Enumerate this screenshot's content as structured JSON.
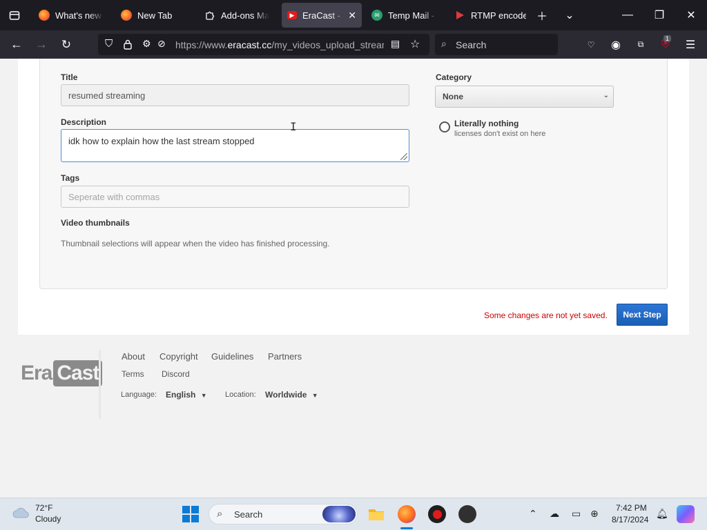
{
  "browser": {
    "tabs": [
      {
        "label": "What's new w",
        "favicon": "firefox-icon",
        "active": false
      },
      {
        "label": "New Tab",
        "favicon": "firefox-icon",
        "active": false
      },
      {
        "label": "Add-ons Mana",
        "favicon": "puzzle-icon",
        "active": false
      },
      {
        "label": "EraCast - Li",
        "favicon": "eracast-icon",
        "active": true
      },
      {
        "label": "Temp Mail - D",
        "favicon": "tempmail-icon",
        "active": false
      },
      {
        "label": "RTMP encoder",
        "favicon": "rtmp-icon",
        "active": false
      }
    ],
    "url_prefix": "https://www.",
    "url_domain": "eracast.cc",
    "url_path": "/my_videos_upload_stream",
    "search_placeholder": "Search",
    "extension_badge": "1"
  },
  "form": {
    "title_label": "Title",
    "title_value": "resumed streaming",
    "description_label": "Description",
    "description_value": "idk how to explain how the last stream stopped",
    "tags_label": "Tags",
    "tags_placeholder": "Seperate with commas",
    "thumbnails_label": "Video thumbnails",
    "thumbnails_note": "Thumbnail selections will appear when the video has finished processing.",
    "category_label": "Category",
    "category_value": "None",
    "license_option_title": "Literally nothing",
    "license_option_sub": "licenses don't exist on here",
    "unsaved_message": "Some changes are not yet saved.",
    "next_button": "Next Step"
  },
  "footer": {
    "logo_era": "Era",
    "logo_cast": "Cast",
    "links_row1": [
      "About",
      "Copyright",
      "Guidelines",
      "Partners"
    ],
    "links_row2": [
      "Terms",
      "Discord"
    ],
    "language_label": "Language:",
    "language_value": "English",
    "location_label": "Location:",
    "location_value": "Worldwide"
  },
  "taskbar": {
    "temperature": "72°F",
    "weather": "Cloudy",
    "search_label": "Search",
    "time": "7:42 PM",
    "date": "8/17/2024"
  },
  "colors": {
    "accent_blue": "#1a5fb4",
    "warning_red": "#cc0000",
    "browser_dark": "#1c1b22"
  }
}
